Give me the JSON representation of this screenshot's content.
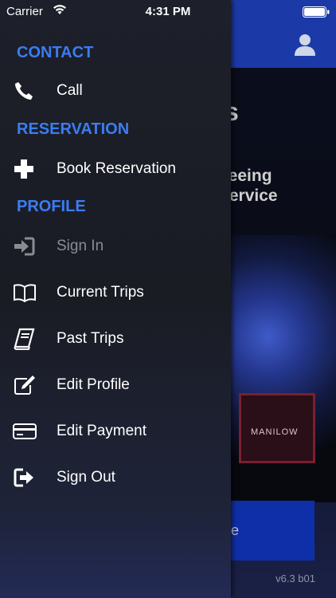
{
  "status_bar": {
    "carrier": "Carrier",
    "time": "4:31 PM"
  },
  "background": {
    "title": "s",
    "subtitle": "tseeing\n Service",
    "photo_sign": "MANILOW",
    "button_label": "e",
    "version": "v6.3  b01"
  },
  "drawer": {
    "sections": {
      "contact": "CONTACT",
      "reservation": "RESERVATION",
      "profile": "PROFILE"
    },
    "items": {
      "call": "Call",
      "book_reservation": "Book Reservation",
      "sign_in": "Sign In",
      "current_trips": "Current Trips",
      "past_trips": "Past Trips",
      "edit_profile": "Edit Profile",
      "edit_payment": "Edit Payment",
      "sign_out": "Sign Out"
    }
  },
  "colors": {
    "accent": "#3b7cf2",
    "header_blue": "#1b3aa8",
    "disabled_text": "#8a8c94"
  },
  "icons": [
    "wifi-icon",
    "battery-icon",
    "user-icon",
    "phone-icon",
    "plus-icon",
    "sign-in-icon",
    "book-open-icon",
    "book-icon",
    "edit-icon",
    "credit-card-icon",
    "sign-out-icon"
  ]
}
